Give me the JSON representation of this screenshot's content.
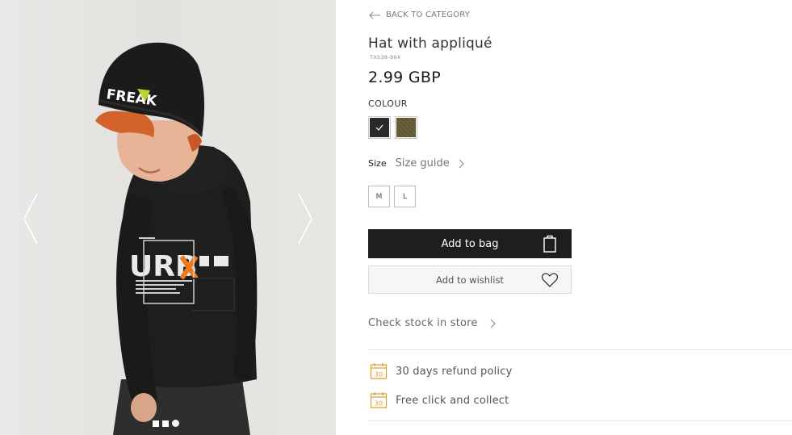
{
  "gallery": {
    "image_alt": "Boy wearing black beanie hat with FREAK appliqué and black URBX sweatshirt",
    "hat_text": "FREAK",
    "shirt_text": "URB",
    "dots": [
      {
        "shape": "square"
      },
      {
        "shape": "square"
      },
      {
        "shape": "circle"
      }
    ],
    "prev_icon": "chevron-left-icon",
    "next_icon": "chevron-right-icon"
  },
  "product": {
    "back_label": "BACK TO CATEGORY",
    "title": "Hat with appliqué",
    "sku": "TXS38-99X",
    "price": "2.99 GBP",
    "colour_label": "COLOUR",
    "colours": [
      {
        "name": "black",
        "hex": "#2a2a2a",
        "selected": true
      },
      {
        "name": "khaki",
        "hex": "#5e5532",
        "selected": false
      }
    ],
    "size_label": "Size",
    "size_guide_label": "Size guide",
    "sizes": [
      "M",
      "L"
    ],
    "add_to_bag_label": "Add to bag",
    "add_to_wishlist_label": "Add to wishlist",
    "check_stock_label": "Check stock in store",
    "perks": [
      {
        "icon": "calendar-30-icon",
        "label": "30 days refund policy",
        "badge": "30"
      },
      {
        "icon": "calendar-30-icon",
        "label": "Free click and collect",
        "badge": "30"
      }
    ]
  },
  "colors": {
    "accent_gold": "#d9a43a",
    "button_dark": "#1e1e1e",
    "hat_logo_green": "#b6d533",
    "shirt_x_orange": "#f07a1a"
  }
}
